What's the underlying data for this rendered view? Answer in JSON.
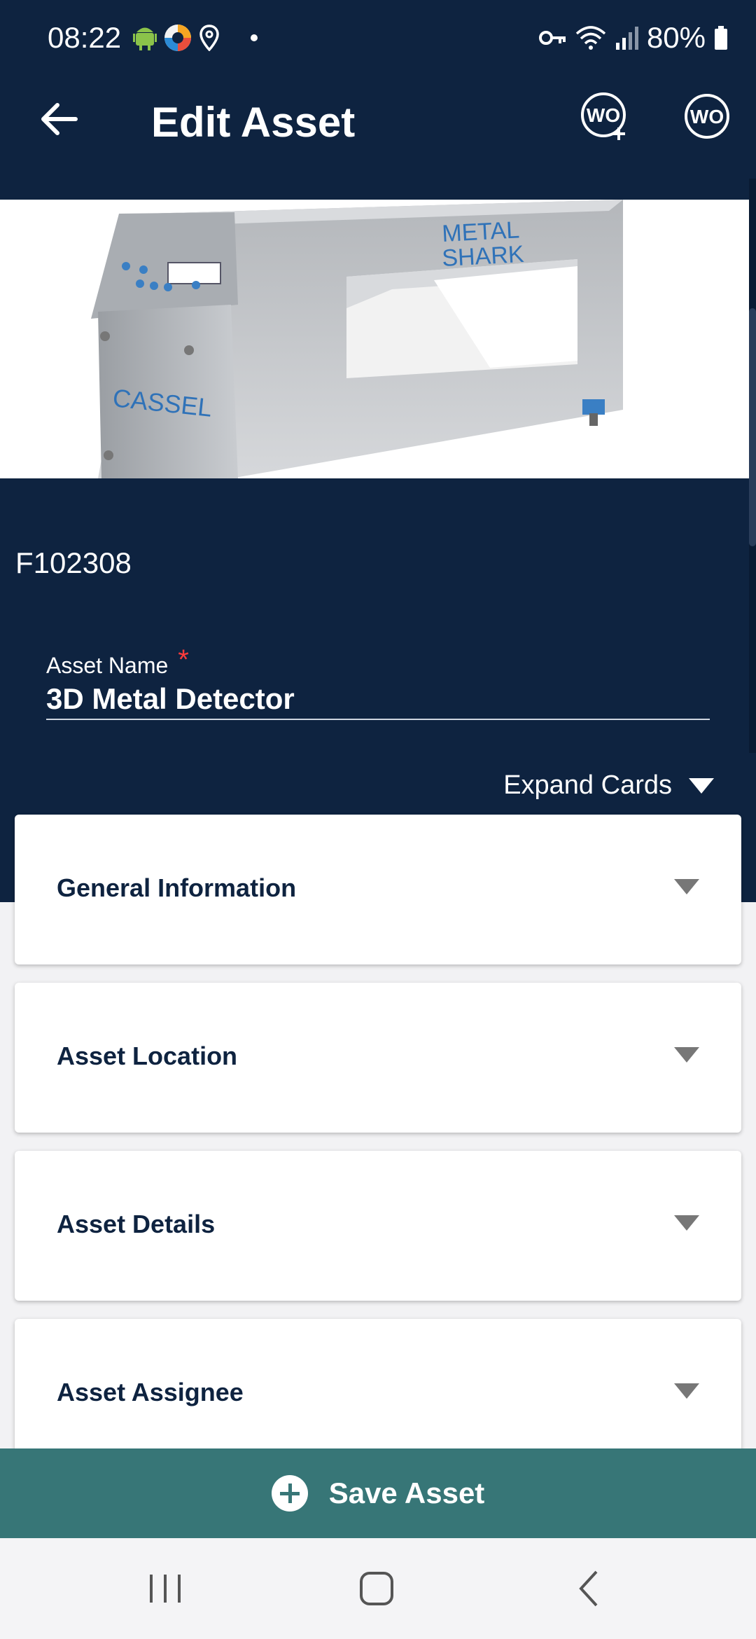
{
  "status_bar": {
    "time": "08:22",
    "battery": "80%"
  },
  "app_bar": {
    "title": "Edit Asset",
    "wo_add_label": "WO",
    "wo_label": "WO"
  },
  "hero": {
    "brand_top": "METAL",
    "brand_bottom": "SHARK",
    "brand_side": "CASSEL"
  },
  "asset": {
    "id": "F102308",
    "name_label": "Asset Name",
    "required_mark": "*",
    "name_value": "3D Metal Detector"
  },
  "expand_label": "Expand Cards",
  "cards": [
    {
      "title": "General Information"
    },
    {
      "title": "Asset Location"
    },
    {
      "title": "Asset Details"
    },
    {
      "title": "Asset Assignee"
    }
  ],
  "save_button": {
    "label": "Save Asset"
  },
  "colors": {
    "header": "#0e2340",
    "save": "#377677",
    "required": "#ff3b3b"
  }
}
